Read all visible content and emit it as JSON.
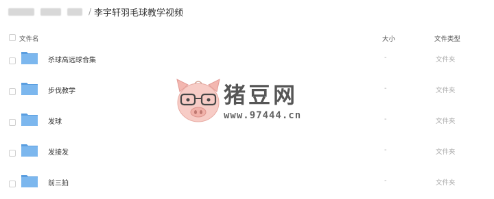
{
  "breadcrumb": {
    "current": "李宇轩羽毛球教学视频",
    "separator": "/"
  },
  "table": {
    "columns": {
      "name": "文件名",
      "size": "大小",
      "type": "文件类型"
    },
    "rows": [
      {
        "name": "杀球高远球合集",
        "size": "-",
        "type": "文件夹"
      },
      {
        "name": "步伐教学",
        "size": "-",
        "type": "文件夹"
      },
      {
        "name": "发球",
        "size": "-",
        "type": "文件夹"
      },
      {
        "name": "发接发",
        "size": "-",
        "type": "文件夹"
      },
      {
        "name": "前三拍",
        "size": "-",
        "type": "文件夹"
      }
    ]
  },
  "watermark": {
    "title": "猪豆网",
    "url": "www.97444.cn"
  },
  "colors": {
    "folder_blue": "#7cb7ee",
    "folder_blue_dark": "#5a9ee0",
    "pig_pink": "#f7c7c0"
  }
}
